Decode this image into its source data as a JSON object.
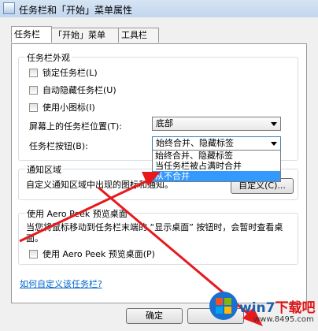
{
  "window": {
    "title": "任务栏和「开始」菜单属性"
  },
  "tabs": [
    {
      "label": "任务栏"
    },
    {
      "label": "「开始」菜单"
    },
    {
      "label": "工具栏"
    }
  ],
  "appearance": {
    "group_label": "任务栏外观",
    "lock_label": "锁定任务栏(L)",
    "autohide_label": "自动隐藏任务栏(U)",
    "small_icons_label": "使用小图标(I)",
    "position_label": "屏幕上的任务栏位置(T):",
    "position_value": "底部",
    "buttons_label": "任务栏按钮(B):",
    "buttons_value": "始终合并、隐藏标签",
    "buttons_options": [
      "始终合并、隐藏标签",
      "当任务栏被占满时合并",
      "从不合并"
    ]
  },
  "notification": {
    "group_label": "通知区域",
    "description": "自定义通知区域中出现的图标和通知。",
    "customize_button": "自定义(C)..."
  },
  "aero_peek": {
    "group_label": "使用 Aero Peek 预览桌面",
    "description": "当您将鼠标移动到任务栏末端的 “显示桌面” 按钮时，会暂时查看桌面。",
    "checkbox_label": "使用 Aero Peek 预览桌面(P)"
  },
  "help_link": "如何自定义该任务栏?",
  "ok_button": "确定",
  "watermark": {
    "brand_prefix": "win7",
    "brand_suffix": "下载吧",
    "url": "www.8495.com"
  },
  "colors": {
    "annotation_arrow": "#e8191c",
    "link": "#0066cc",
    "highlight": "#3399ff"
  }
}
